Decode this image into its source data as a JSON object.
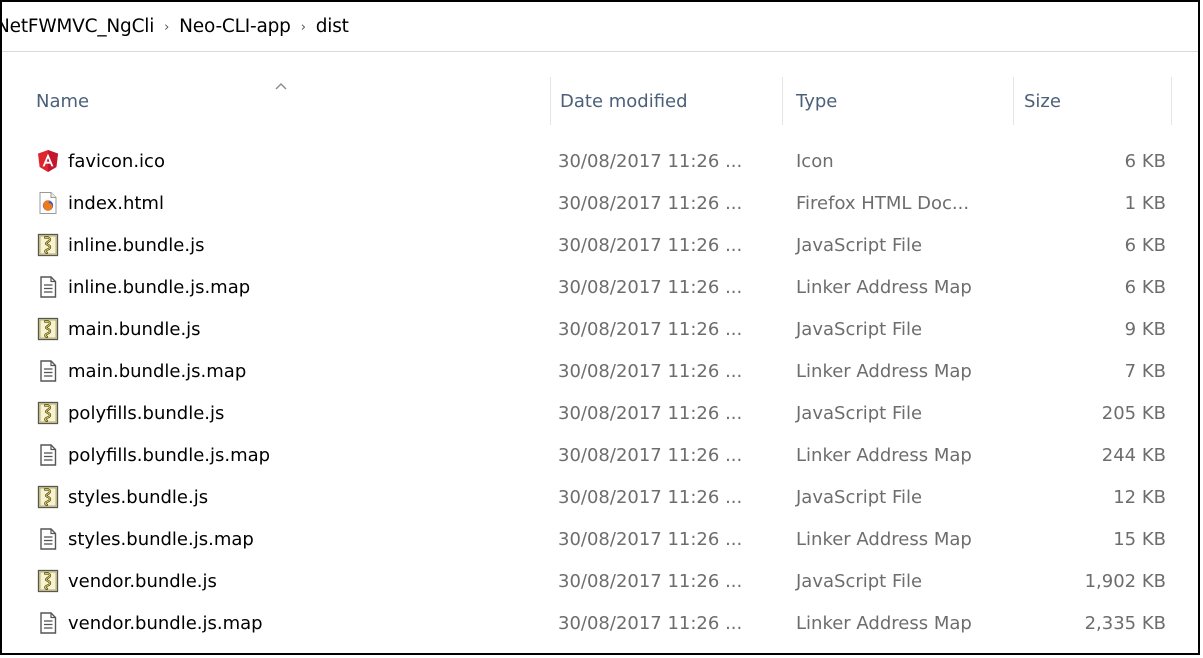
{
  "breadcrumb": {
    "items": [
      "NetFWMVC_NgCli",
      "Neo-CLI-app",
      "dist"
    ],
    "separator": "›"
  },
  "columns": {
    "name": "Name",
    "date": "Date modified",
    "type": "Type",
    "size": "Size",
    "sorted_column": "name",
    "sort_direction": "ascending"
  },
  "files": [
    {
      "name": "favicon.ico",
      "date": "30/08/2017 11:26 ...",
      "type": "Icon",
      "size": "6 KB",
      "icon": "angular-icon"
    },
    {
      "name": "index.html",
      "date": "30/08/2017 11:26 ...",
      "type": "Firefox HTML Doc...",
      "size": "1 KB",
      "icon": "firefox-html-icon"
    },
    {
      "name": "inline.bundle.js",
      "date": "30/08/2017 11:26 ...",
      "type": "JavaScript File",
      "size": "6 KB",
      "icon": "javascript-file-icon"
    },
    {
      "name": "inline.bundle.js.map",
      "date": "30/08/2017 11:26 ...",
      "type": "Linker Address Map",
      "size": "6 KB",
      "icon": "text-document-icon"
    },
    {
      "name": "main.bundle.js",
      "date": "30/08/2017 11:26 ...",
      "type": "JavaScript File",
      "size": "9 KB",
      "icon": "javascript-file-icon"
    },
    {
      "name": "main.bundle.js.map",
      "date": "30/08/2017 11:26 ...",
      "type": "Linker Address Map",
      "size": "7 KB",
      "icon": "text-document-icon"
    },
    {
      "name": "polyfills.bundle.js",
      "date": "30/08/2017 11:26 ...",
      "type": "JavaScript File",
      "size": "205 KB",
      "icon": "javascript-file-icon"
    },
    {
      "name": "polyfills.bundle.js.map",
      "date": "30/08/2017 11:26 ...",
      "type": "Linker Address Map",
      "size": "244 KB",
      "icon": "text-document-icon"
    },
    {
      "name": "styles.bundle.js",
      "date": "30/08/2017 11:26 ...",
      "type": "JavaScript File",
      "size": "12 KB",
      "icon": "javascript-file-icon"
    },
    {
      "name": "styles.bundle.js.map",
      "date": "30/08/2017 11:26 ...",
      "type": "Linker Address Map",
      "size": "15 KB",
      "icon": "text-document-icon"
    },
    {
      "name": "vendor.bundle.js",
      "date": "30/08/2017 11:26 ...",
      "type": "JavaScript File",
      "size": "1,902 KB",
      "icon": "javascript-file-icon"
    },
    {
      "name": "vendor.bundle.js.map",
      "date": "30/08/2017 11:26 ...",
      "type": "Linker Address Map",
      "size": "2,335 KB",
      "icon": "text-document-icon"
    }
  ]
}
